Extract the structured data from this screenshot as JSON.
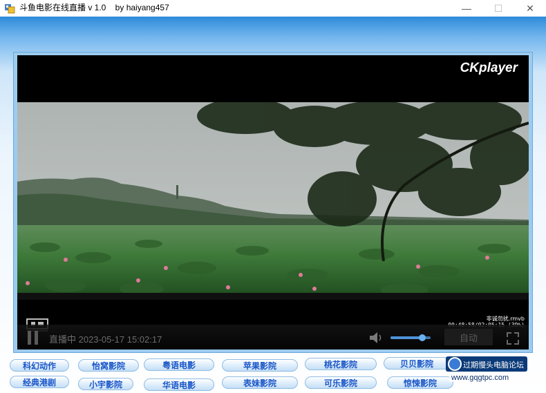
{
  "window": {
    "title": "斗鱼电影在线直播 v 1.0    by haiyang457",
    "minimize": "—",
    "maximize": "☐",
    "close": "✕"
  },
  "player": {
    "logo": "CKplayer",
    "overlay_title": "非诚勿扰.rmvb",
    "overlay_time": "00:48:58/02:05:15 (39%)",
    "status": "直播中 2023-05-17 15:02:17",
    "auto_button": "自动",
    "volume_level": 0.8,
    "colors": {
      "accent": "#4f93d8",
      "control_bg": "#0d0d0d"
    }
  },
  "cinemas": {
    "row1": [
      "科幻动作",
      "怡窝影院",
      "粤语电影",
      "苹果影院",
      "桃花影院",
      "贝贝影院"
    ],
    "row2": [
      "经典港剧",
      "小宇影院",
      "华语电影",
      "表妹影院",
      "可乐影院",
      "惊悚影院"
    ]
  },
  "watermark": {
    "text": "过期慢头电脑论坛",
    "url": "www.gqgtpc.com"
  }
}
